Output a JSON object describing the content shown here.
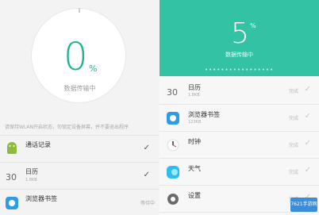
{
  "left": {
    "gauge": {
      "value": "0",
      "unit": "%",
      "caption": "数据传输中"
    },
    "tip": "请保持WLAN开启状态，勿锁定设备屏幕，并不要退出程序",
    "items": [
      {
        "title": "通话记录",
        "subtitle": "",
        "status": "✓",
        "icon": "android-icon"
      },
      {
        "title": "日历",
        "subtitle": "1.8KB",
        "status": "✓",
        "icon": "calendar-icon"
      },
      {
        "title": "浏览器书签",
        "subtitle": "",
        "status": "等待中",
        "icon": "browser-icon"
      }
    ]
  },
  "right": {
    "counter": {
      "value": "5",
      "unit": "%",
      "caption": "数据传输中"
    },
    "dots": "•••••••••••••••••",
    "items": [
      {
        "title": "日历",
        "subtitle": "1.8KB",
        "status": "完成",
        "icon": "calendar-icon"
      },
      {
        "title": "浏览器书签",
        "subtitle": "123KB",
        "status": "完成",
        "icon": "browser-icon"
      },
      {
        "title": "时钟",
        "subtitle": "",
        "status": "完成",
        "icon": "clock-icon"
      },
      {
        "title": "天气",
        "subtitle": "",
        "status": "完成",
        "icon": "weather-icon"
      },
      {
        "title": "设置",
        "subtitle": "",
        "status": "完成",
        "icon": "settings-icon"
      }
    ]
  },
  "watermark": "7621手游网"
}
